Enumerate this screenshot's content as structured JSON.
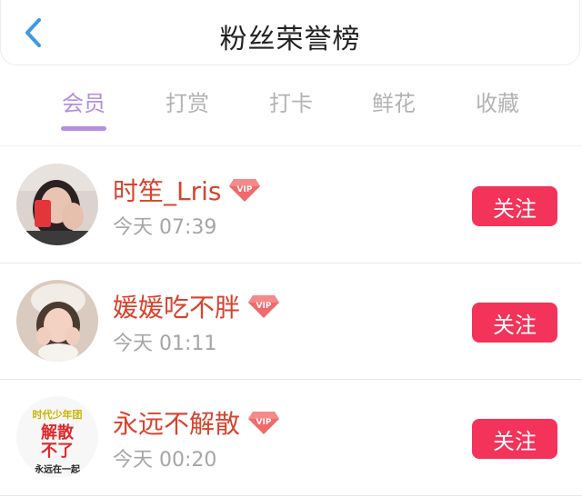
{
  "header": {
    "title": "粉丝荣誉榜",
    "back_icon": "chevron-left-icon"
  },
  "tabs": [
    {
      "label": "会员",
      "active": true
    },
    {
      "label": "打赏",
      "active": false
    },
    {
      "label": "打卡",
      "active": false
    },
    {
      "label": "鲜花",
      "active": false
    },
    {
      "label": "收藏",
      "active": false
    }
  ],
  "fans": [
    {
      "name": "时笙_Lris",
      "time": "今天 07:39",
      "follow_label": "关注",
      "badge": "VIP"
    },
    {
      "name": "媛媛吃不胖",
      "time": "今天 01:11",
      "follow_label": "关注",
      "badge": "VIP"
    },
    {
      "name": "永远不解散",
      "time": "今天 00:20",
      "follow_label": "关注",
      "badge": "VIP",
      "avatar_text": {
        "top": "时代少年团",
        "mid1": "解散",
        "mid2": "不了",
        "bottom": "永远在一起"
      }
    }
  ],
  "colors": {
    "accent": "#b48fe0",
    "name": "#d8432e",
    "follow_button": "#f3335a",
    "back_icon": "#3a9be6",
    "vip_badge": "#f06a6a"
  }
}
